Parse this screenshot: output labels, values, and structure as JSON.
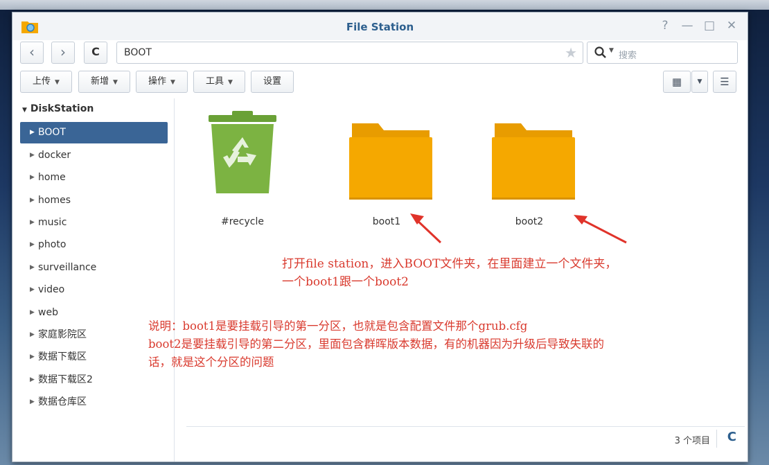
{
  "window": {
    "title": "File Station"
  },
  "titlebar": {
    "help": "?",
    "minimize": "—",
    "maximize": "□",
    "close": "✕"
  },
  "nav": {
    "back": "‹",
    "forward": "›",
    "refresh": "C",
    "path": "BOOT",
    "favorite": "★"
  },
  "search": {
    "placeholder": "搜索"
  },
  "toolbar": {
    "upload": "上传",
    "create": "新增",
    "action": "操作",
    "tools": "工具",
    "settings": "设置"
  },
  "sidebar": {
    "root": "DiskStation",
    "items": [
      {
        "label": "BOOT",
        "selected": true
      },
      {
        "label": "docker"
      },
      {
        "label": "home"
      },
      {
        "label": "homes"
      },
      {
        "label": "music"
      },
      {
        "label": "photo"
      },
      {
        "label": "surveillance"
      },
      {
        "label": "video"
      },
      {
        "label": "web"
      },
      {
        "label": "家庭影院区"
      },
      {
        "label": "数据下载区"
      },
      {
        "label": "数据下载区2"
      },
      {
        "label": "数据仓库区"
      }
    ]
  },
  "files": [
    {
      "name": "#recycle",
      "icon": "recycle-bin-icon"
    },
    {
      "name": "boot1",
      "icon": "folder-icon"
    },
    {
      "name": "boot2",
      "icon": "folder-icon"
    }
  ],
  "annotations": {
    "note1_line1": "打开file station，进入BOOT文件夹，在里面建立一个文件夹，",
    "note1_line2": "一个boot1跟一个boot2",
    "note2_line1": "说明：boot1是要挂载引导的第一分区，也就是包含配置文件那个grub.cfg",
    "note2_line2": "boot2是要挂载引导的第二分区，里面包含群晖版本数据，有的机器因为升级后导致失联的",
    "note2_line3": "话，就是这个分区的问题"
  },
  "status": {
    "count": "3 个项目",
    "refresh": "C"
  },
  "colors": {
    "title": "#2d5f8e",
    "selected": "#3a6596",
    "folder": "#f5a800",
    "recycle": "#7cb342",
    "annotation": "#d93a2e"
  }
}
